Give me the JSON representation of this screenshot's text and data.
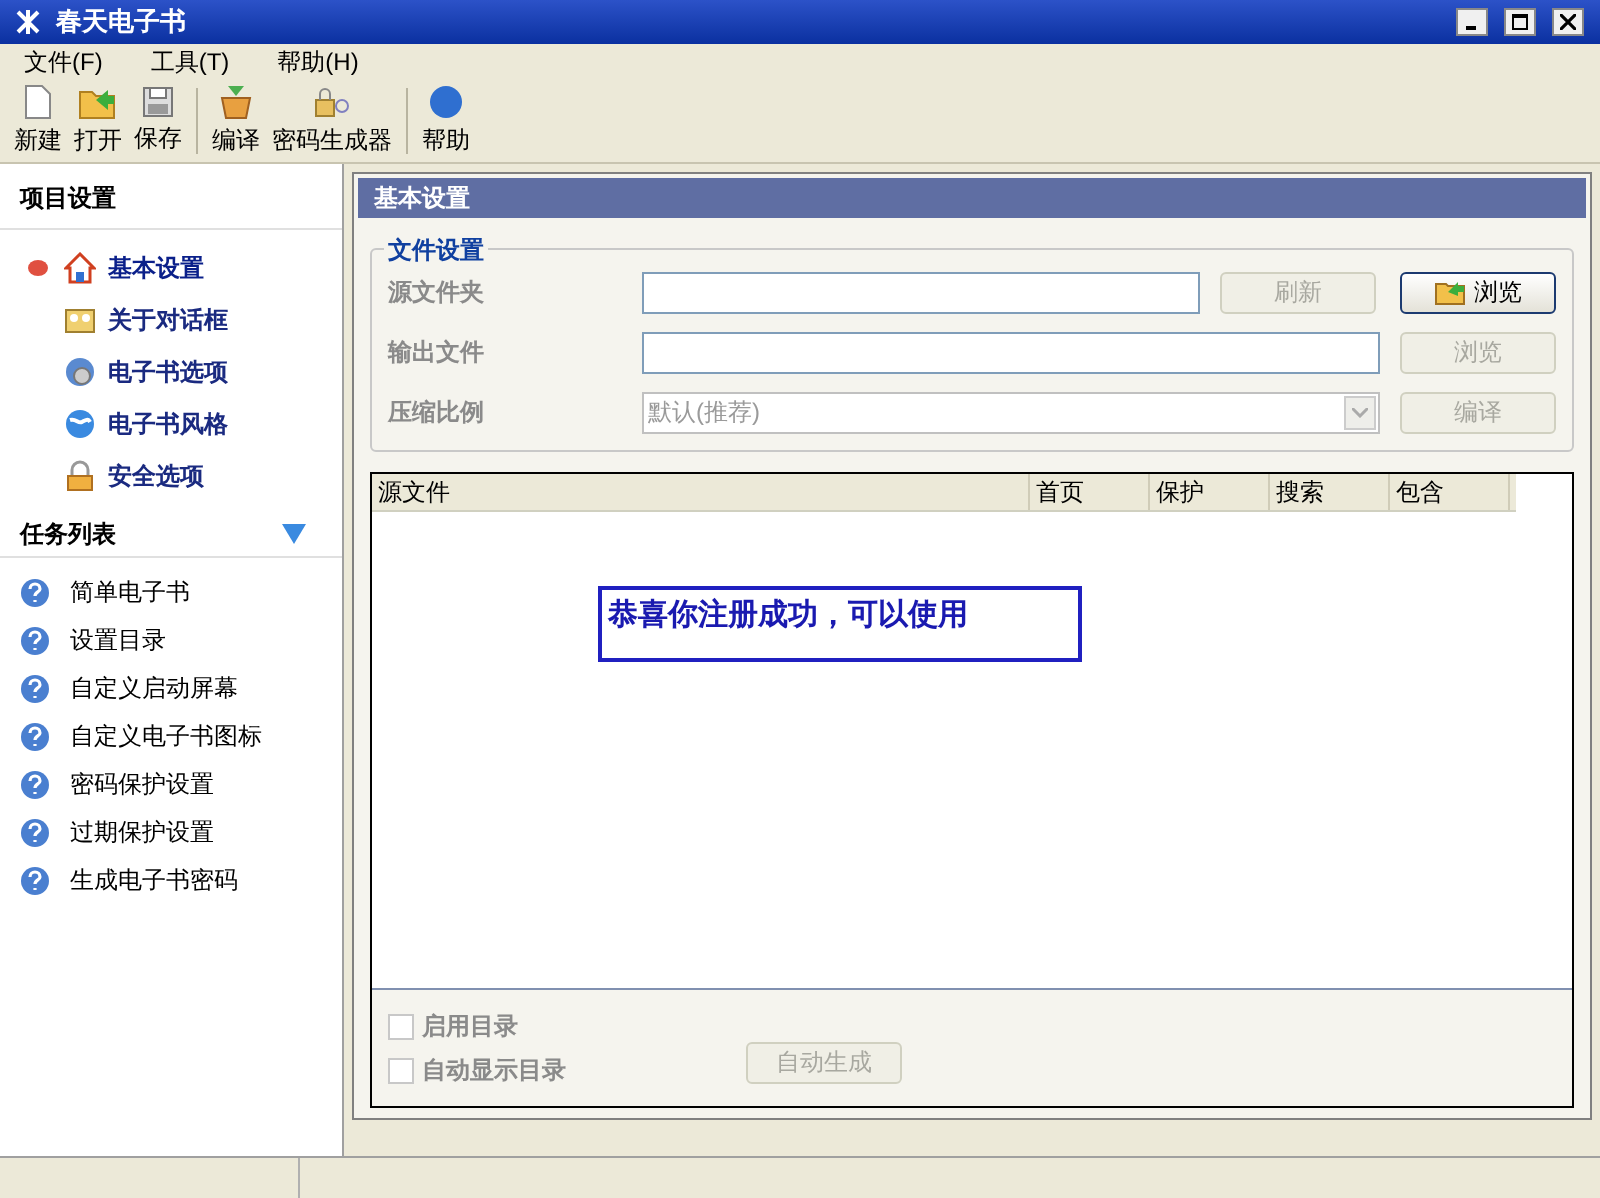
{
  "window": {
    "title": "春天电子书"
  },
  "menu": [
    {
      "label": "文件(F)"
    },
    {
      "label": "工具(T)"
    },
    {
      "label": "帮助(H)"
    }
  ],
  "toolbar": [
    [
      {
        "label": "新建"
      },
      {
        "label": "打开"
      },
      {
        "label": "保存"
      }
    ],
    [
      {
        "label": "编译"
      },
      {
        "label": "密码生成器"
      }
    ],
    [
      {
        "label": "帮助"
      }
    ]
  ],
  "sidebar": {
    "project_settings": {
      "title": "项目设置",
      "items": [
        {
          "label": "基本设置",
          "selected": true
        },
        {
          "label": "关于对话框",
          "selected": false
        },
        {
          "label": "电子书选项",
          "selected": false
        },
        {
          "label": "电子书风格",
          "selected": false
        },
        {
          "label": "安全选项",
          "selected": false
        }
      ]
    },
    "task_list": {
      "title": "任务列表",
      "expanded": true,
      "items": [
        {
          "label": "简单电子书"
        },
        {
          "label": "设置目录"
        },
        {
          "label": "自定义启动屏幕"
        },
        {
          "label": "自定义电子书图标"
        },
        {
          "label": "密码保护设置"
        },
        {
          "label": "过期保护设置"
        },
        {
          "label": "生成电子书密码"
        }
      ]
    }
  },
  "panel": {
    "title": "基本设置",
    "group": {
      "title": "文件设置",
      "rows": [
        {
          "label": "源文件夹",
          "kind": "input",
          "buttons": [
            {
              "label": "刷新",
              "disabled": true
            },
            {
              "label": "浏览",
              "disabled": false
            }
          ]
        },
        {
          "label": "输出文件",
          "kind": "input",
          "buttons": [
            {
              "label": "浏览",
              "disabled": true
            }
          ]
        },
        {
          "label": "压缩比例",
          "kind": "select",
          "value": "默认(推荐)",
          "buttons": [
            {
              "label": "编译",
              "disabled": true
            }
          ]
        }
      ]
    },
    "table": {
      "columns": [
        "源文件",
        "首页",
        "保护",
        "搜索",
        "包含"
      ]
    },
    "message": "恭喜你注册成功，可以使用",
    "checkboxes": [
      {
        "label": "启用目录",
        "checked": false,
        "disabled": true
      },
      {
        "label": "自动显示目录",
        "checked": false,
        "disabled": true
      }
    ],
    "generate_button": {
      "label": "自动生成",
      "disabled": true
    }
  }
}
